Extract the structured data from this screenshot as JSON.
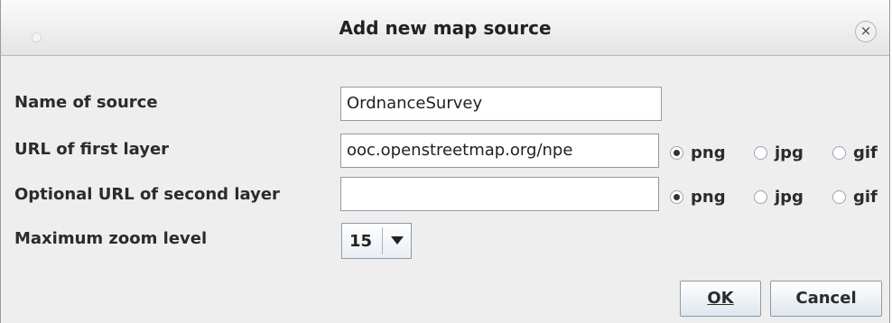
{
  "dialog": {
    "title": "Add new map source",
    "close_glyph": "×"
  },
  "form": {
    "name_label": "Name of source",
    "name_value": "OrdnanceSurvey",
    "url1_label": "URL of first layer",
    "url1_value": "ooc.openstreetmap.org/npe",
    "url2_label": "Optional URL of second layer",
    "url2_value": "",
    "zoom_label": "Maximum zoom level",
    "zoom_value": "15",
    "formats": [
      "png",
      "jpg",
      "gif"
    ],
    "layer1_selected": "png",
    "layer2_selected": "png"
  },
  "buttons": {
    "ok": "OK",
    "cancel": "Cancel"
  }
}
